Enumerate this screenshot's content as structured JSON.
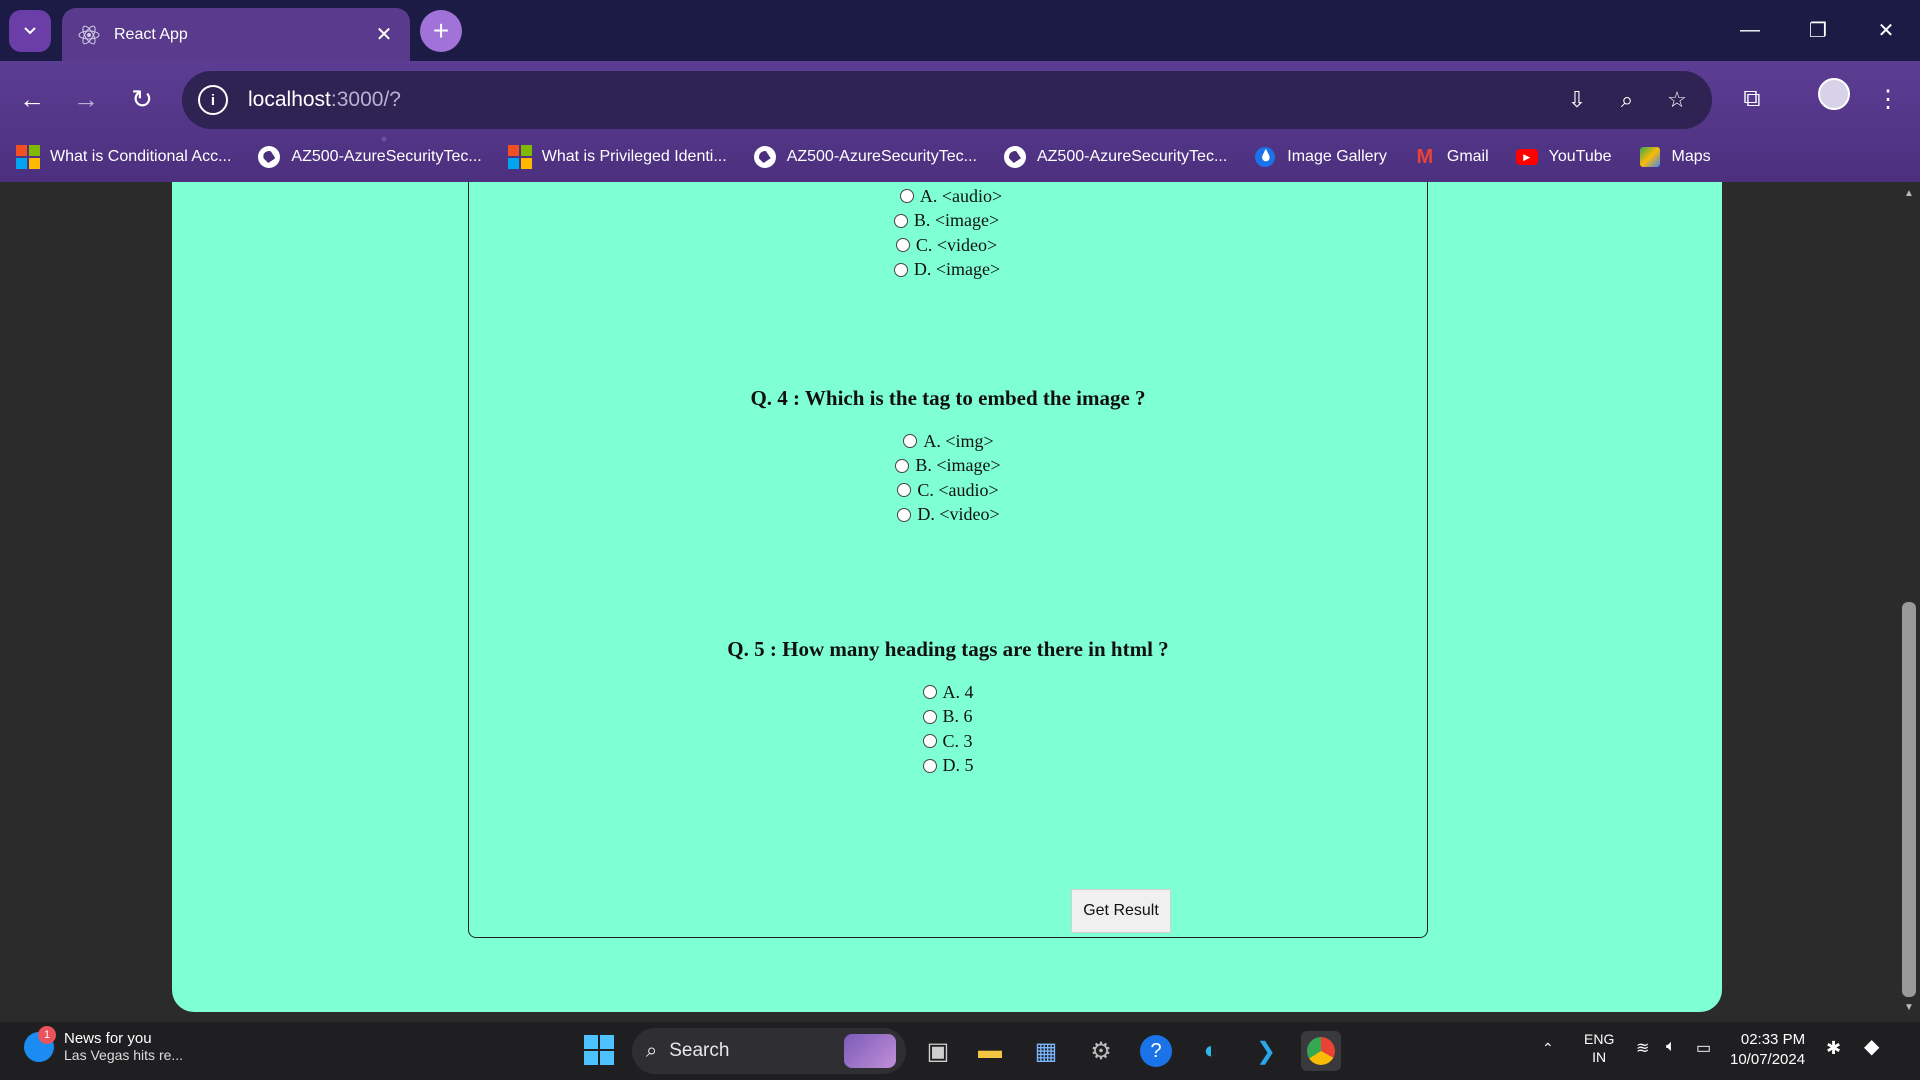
{
  "browser": {
    "tab_title": "React App",
    "url_host": "localhost",
    "url_path": ":3000/?",
    "bookmarks": [
      {
        "label": "What is Conditional Acc...",
        "icon": "microsoft-icon"
      },
      {
        "label": "AZ500-AzureSecurityTec...",
        "icon": "globe-icon"
      },
      {
        "label": "What is Privileged Identi...",
        "icon": "microsoft-icon"
      },
      {
        "label": "AZ500-AzureSecurityTec...",
        "icon": "globe-icon"
      },
      {
        "label": "AZ500-AzureSecurityTec...",
        "icon": "globe-icon"
      },
      {
        "label": "Image Gallery",
        "icon": "drop-icon"
      },
      {
        "label": "Gmail",
        "icon": "gmail-icon"
      },
      {
        "label": "YouTube",
        "icon": "youtube-icon"
      },
      {
        "label": "Maps",
        "icon": "maps-icon"
      }
    ]
  },
  "quiz": {
    "q3": {
      "options": [
        "A. <audio>",
        "B. <image>",
        "C. <video>",
        "D. <image>"
      ]
    },
    "q4": {
      "question": "Q. 4 : Which is the tag to embed the image ?",
      "options": [
        "A. <img>",
        "B. <image>",
        "C. <audio>",
        "D. <video>"
      ]
    },
    "q5": {
      "question": "Q. 5 : How many heading tags are there in html ?",
      "options": [
        "A. 4",
        "B. 6",
        "C. 3",
        "D. 5"
      ]
    },
    "submit_label": "Get Result"
  },
  "taskbar": {
    "news_title": "News for you",
    "news_sub": "Las Vegas hits re...",
    "news_badge": "1",
    "search_placeholder": "Search",
    "lang_line1": "ENG",
    "lang_line2": "IN",
    "time": "02:33 PM",
    "date": "10/07/2024"
  },
  "colors": {
    "page_bg": "#7fffd4",
    "chrome_theme": "#4b2f7d"
  }
}
